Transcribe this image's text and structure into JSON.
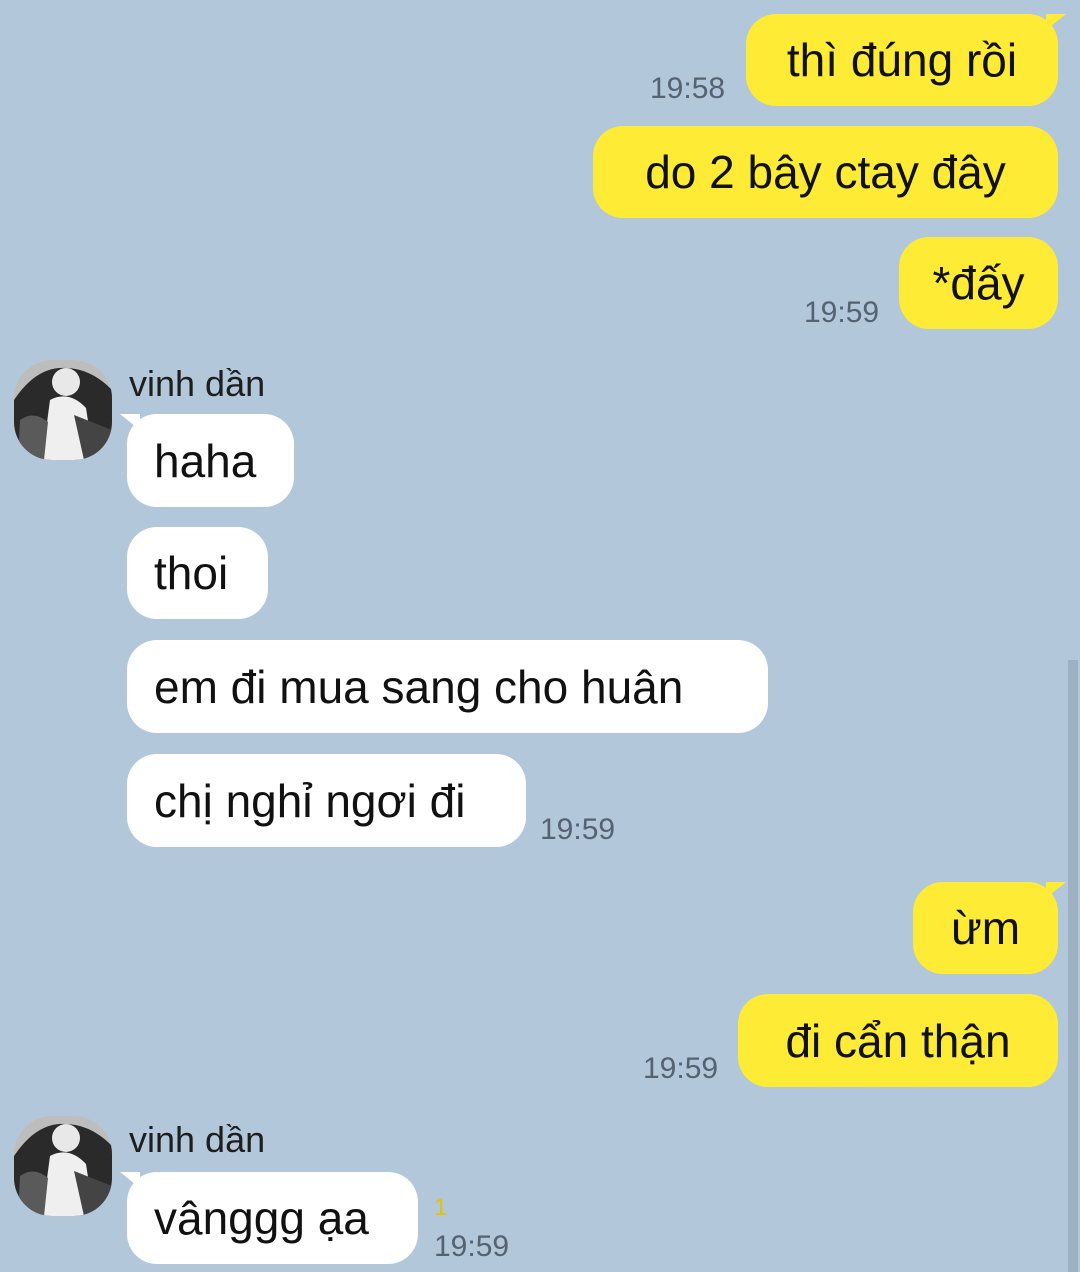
{
  "messages": [
    {
      "sender": "me",
      "text": "thì đúng rồi",
      "time": "19:58"
    },
    {
      "sender": "me",
      "text": "do 2 bây ctay đây"
    },
    {
      "sender": "me",
      "text": "*đấy",
      "time": "19:59"
    },
    {
      "sender": "vinh dần",
      "text": "haha"
    },
    {
      "sender": "vinh dần",
      "text": "thoi"
    },
    {
      "sender": "vinh dần",
      "text": "em đi mua sang cho huân"
    },
    {
      "sender": "vinh dần",
      "text": "chị nghỉ ngơi đi",
      "time": "19:59"
    },
    {
      "sender": "me",
      "text": "ừm"
    },
    {
      "sender": "me",
      "text": "đi cẩn thận",
      "time": "19:59"
    },
    {
      "sender": "vinh dần",
      "text": "vânggg ạa",
      "time": "19:59",
      "unread": "1"
    }
  ],
  "contact": {
    "name": "vinh dần",
    "avatar_icon": "profile-photo-icon"
  },
  "colors": {
    "background": "#B2C7DA",
    "my_bubble": "#FEEB35",
    "their_bubble": "#FFFFFF",
    "unread_count": "#E2C400",
    "timestamp": "#556270"
  }
}
